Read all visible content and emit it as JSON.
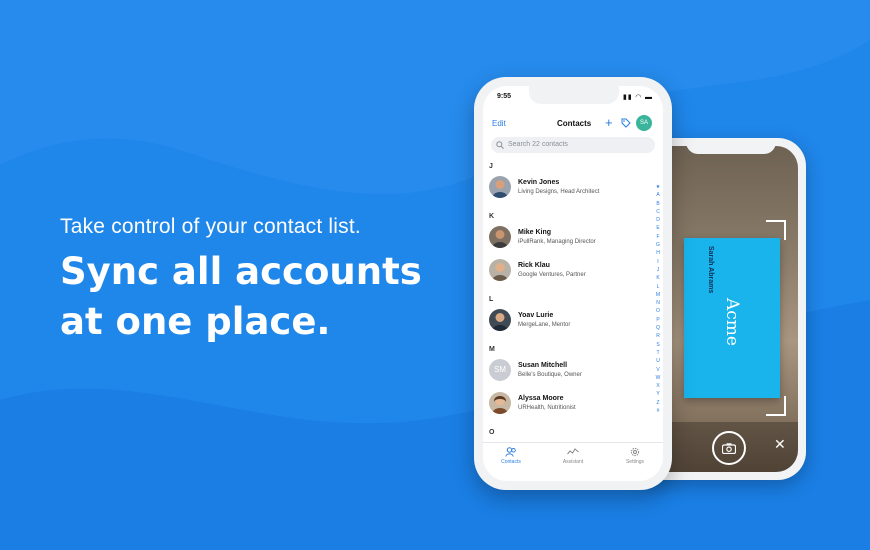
{
  "headline": {
    "tagline": "Take control of your contact list.",
    "line1": "Sync all accounts",
    "line2": "at one place."
  },
  "colors": {
    "background": "#1f86ea",
    "accent": "#2a7de1",
    "card": "#19b4ec"
  },
  "app": {
    "status_time": "9:55",
    "edit_label": "Edit",
    "title": "Contacts",
    "avatar_initials": "SA",
    "search_placeholder": "Search 22 contacts",
    "sections": [
      {
        "letter": "J",
        "contacts": [
          {
            "name": "Kevin Jones",
            "subtitle": "Living Designs, Head Architect"
          }
        ]
      },
      {
        "letter": "K",
        "contacts": [
          {
            "name": "Mike King",
            "subtitle": "iPullRank, Managing Director"
          },
          {
            "name": "Rick Klau",
            "subtitle": "Google Ventures, Partner"
          }
        ]
      },
      {
        "letter": "L",
        "contacts": [
          {
            "name": "Yoav Lurie",
            "subtitle": "MergeLane, Mentor"
          }
        ]
      },
      {
        "letter": "M",
        "contacts": [
          {
            "name": "Susan Mitchell",
            "subtitle": "Belle's Boutique, Owner",
            "initials": "SM"
          },
          {
            "name": "Alyssa Moore",
            "subtitle": "URHealth, Nutritionist"
          }
        ]
      },
      {
        "letter": "O",
        "contacts": []
      }
    ],
    "alphabet": "★ A B C D E F G H I J K L M N O P Q R S T U V W X Y Z #",
    "tabs": [
      "Contacts",
      "Assistant",
      "Settings"
    ]
  },
  "scanner": {
    "card_brand": "Acme",
    "card_name": "Sarah Abrams"
  }
}
